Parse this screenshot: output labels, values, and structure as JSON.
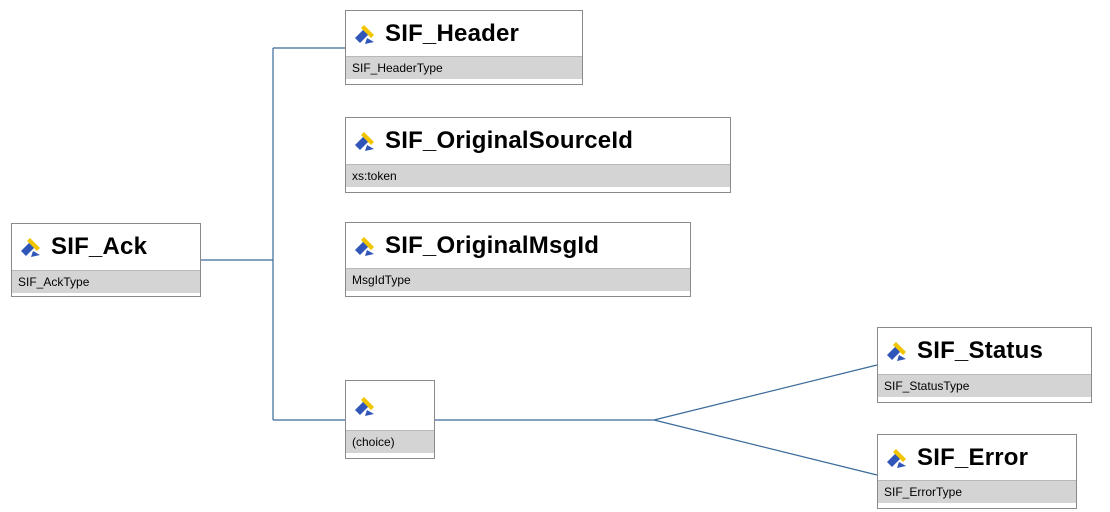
{
  "diagram": {
    "line_color": "#3a6b9a",
    "type_bar_color": "#d4d4d4",
    "root": {
      "name": "SIF_Ack",
      "type": "SIF_AckType",
      "icon": "element-icon"
    },
    "children": [
      {
        "name": "SIF_Header",
        "type": "SIF_HeaderType",
        "icon": "element-icon"
      },
      {
        "name": "SIF_OriginalSourceId",
        "type": "xs:token",
        "icon": "element-icon"
      },
      {
        "name": "SIF_OriginalMsgId",
        "type": "MsgIdType",
        "icon": "element-icon"
      }
    ],
    "choice": {
      "label": "(choice)",
      "icon": "element-icon",
      "options": [
        {
          "name": "SIF_Status",
          "type": "SIF_StatusType",
          "icon": "element-icon"
        },
        {
          "name": "SIF_Error",
          "type": "SIF_ErrorType",
          "icon": "element-icon"
        }
      ]
    }
  }
}
